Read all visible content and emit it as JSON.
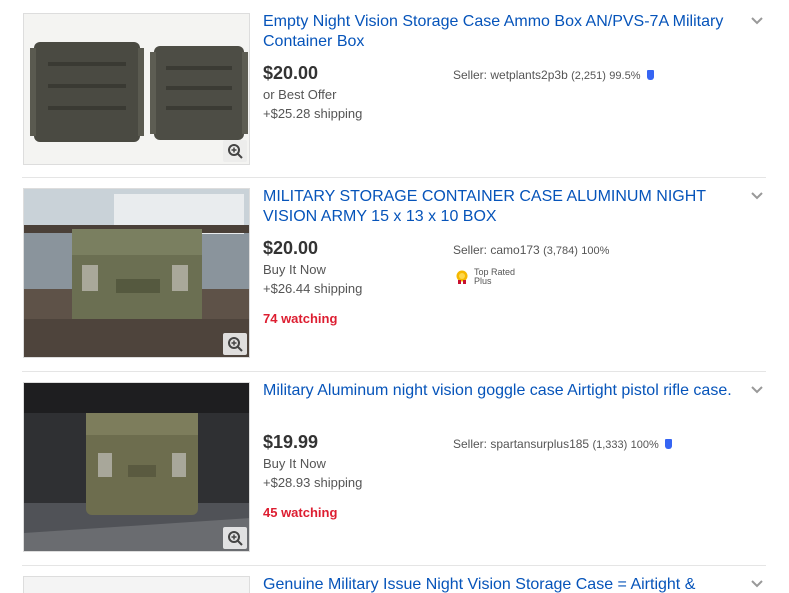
{
  "listings": [
    {
      "title": "Empty Night Vision Storage Case Ammo Box AN/PVS-7A Military Container Box",
      "price": "$20.00",
      "format": "or Best Offer",
      "shipping": "+$25.28 shipping",
      "watching": "",
      "seller_label": "Seller:",
      "seller_name": "wetplants2p3b",
      "seller_feedback": "(2,251)",
      "seller_percent": "99.5%",
      "top_rated": false
    },
    {
      "title": "MILITARY STORAGE CONTAINER CASE ALUMINUM NIGHT VISION ARMY 15 x 13 x 10 BOX",
      "price": "$20.00",
      "format": "Buy It Now",
      "shipping": "+$26.44 shipping",
      "watching": "74 watching",
      "seller_label": "Seller:",
      "seller_name": "camo173",
      "seller_feedback": "(3,784)",
      "seller_percent": "100%",
      "top_rated": true,
      "top_rated_line1": "Top Rated",
      "top_rated_line2": "Plus"
    },
    {
      "title": "Military Aluminum night vision goggle case Airtight pistol rifle case.",
      "price": "$19.99",
      "format": "Buy It Now",
      "shipping": "+$28.93 shipping",
      "watching": "45 watching",
      "seller_label": "Seller:",
      "seller_name": "spartansurplus185",
      "seller_feedback": "(1,333)",
      "seller_percent": "100%",
      "top_rated": false
    },
    {
      "title": "Genuine Military Issue Night Vision Storage Case = Airtight &"
    }
  ],
  "colors": {
    "title_link": "#0654ba",
    "watching": "#dd1e31",
    "price": "#333333"
  },
  "icons": [
    "zoom-icon",
    "chevron-down-icon",
    "top-rated-badge-icon",
    "ebay-guarantee-icon"
  ]
}
